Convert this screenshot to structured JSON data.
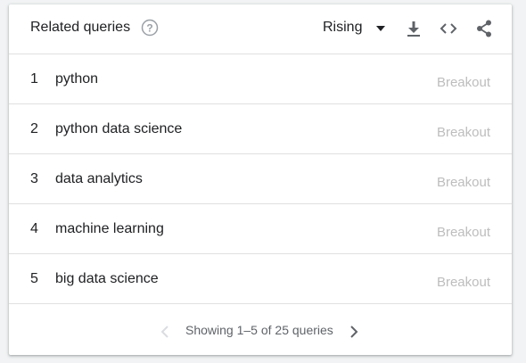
{
  "header": {
    "title": "Related queries",
    "help_icon": "help-circle-icon",
    "select": {
      "value": "Rising",
      "icon": "triangle-down-icon"
    },
    "tools": {
      "download_icon": "download-icon",
      "embed_icon": "code-embed-icon",
      "share_icon": "share-icon"
    }
  },
  "rows": [
    {
      "rank": "1",
      "query": "python",
      "value": "Breakout"
    },
    {
      "rank": "2",
      "query": "python data science",
      "value": "Breakout"
    },
    {
      "rank": "3",
      "query": "data analytics",
      "value": "Breakout"
    },
    {
      "rank": "4",
      "query": "machine learning",
      "value": "Breakout"
    },
    {
      "rank": "5",
      "query": "big data science",
      "value": "Breakout"
    }
  ],
  "footer": {
    "pager_text": "Showing 1–5 of 25 queries",
    "prev_icon": "chevron-left-icon",
    "next_icon": "chevron-right-icon"
  },
  "colors": {
    "text": "#202124",
    "muted": "#bdbdbd",
    "icon": "#5f6368",
    "disabled_icon": "#dadce0",
    "divider": "#e0e0e0"
  }
}
